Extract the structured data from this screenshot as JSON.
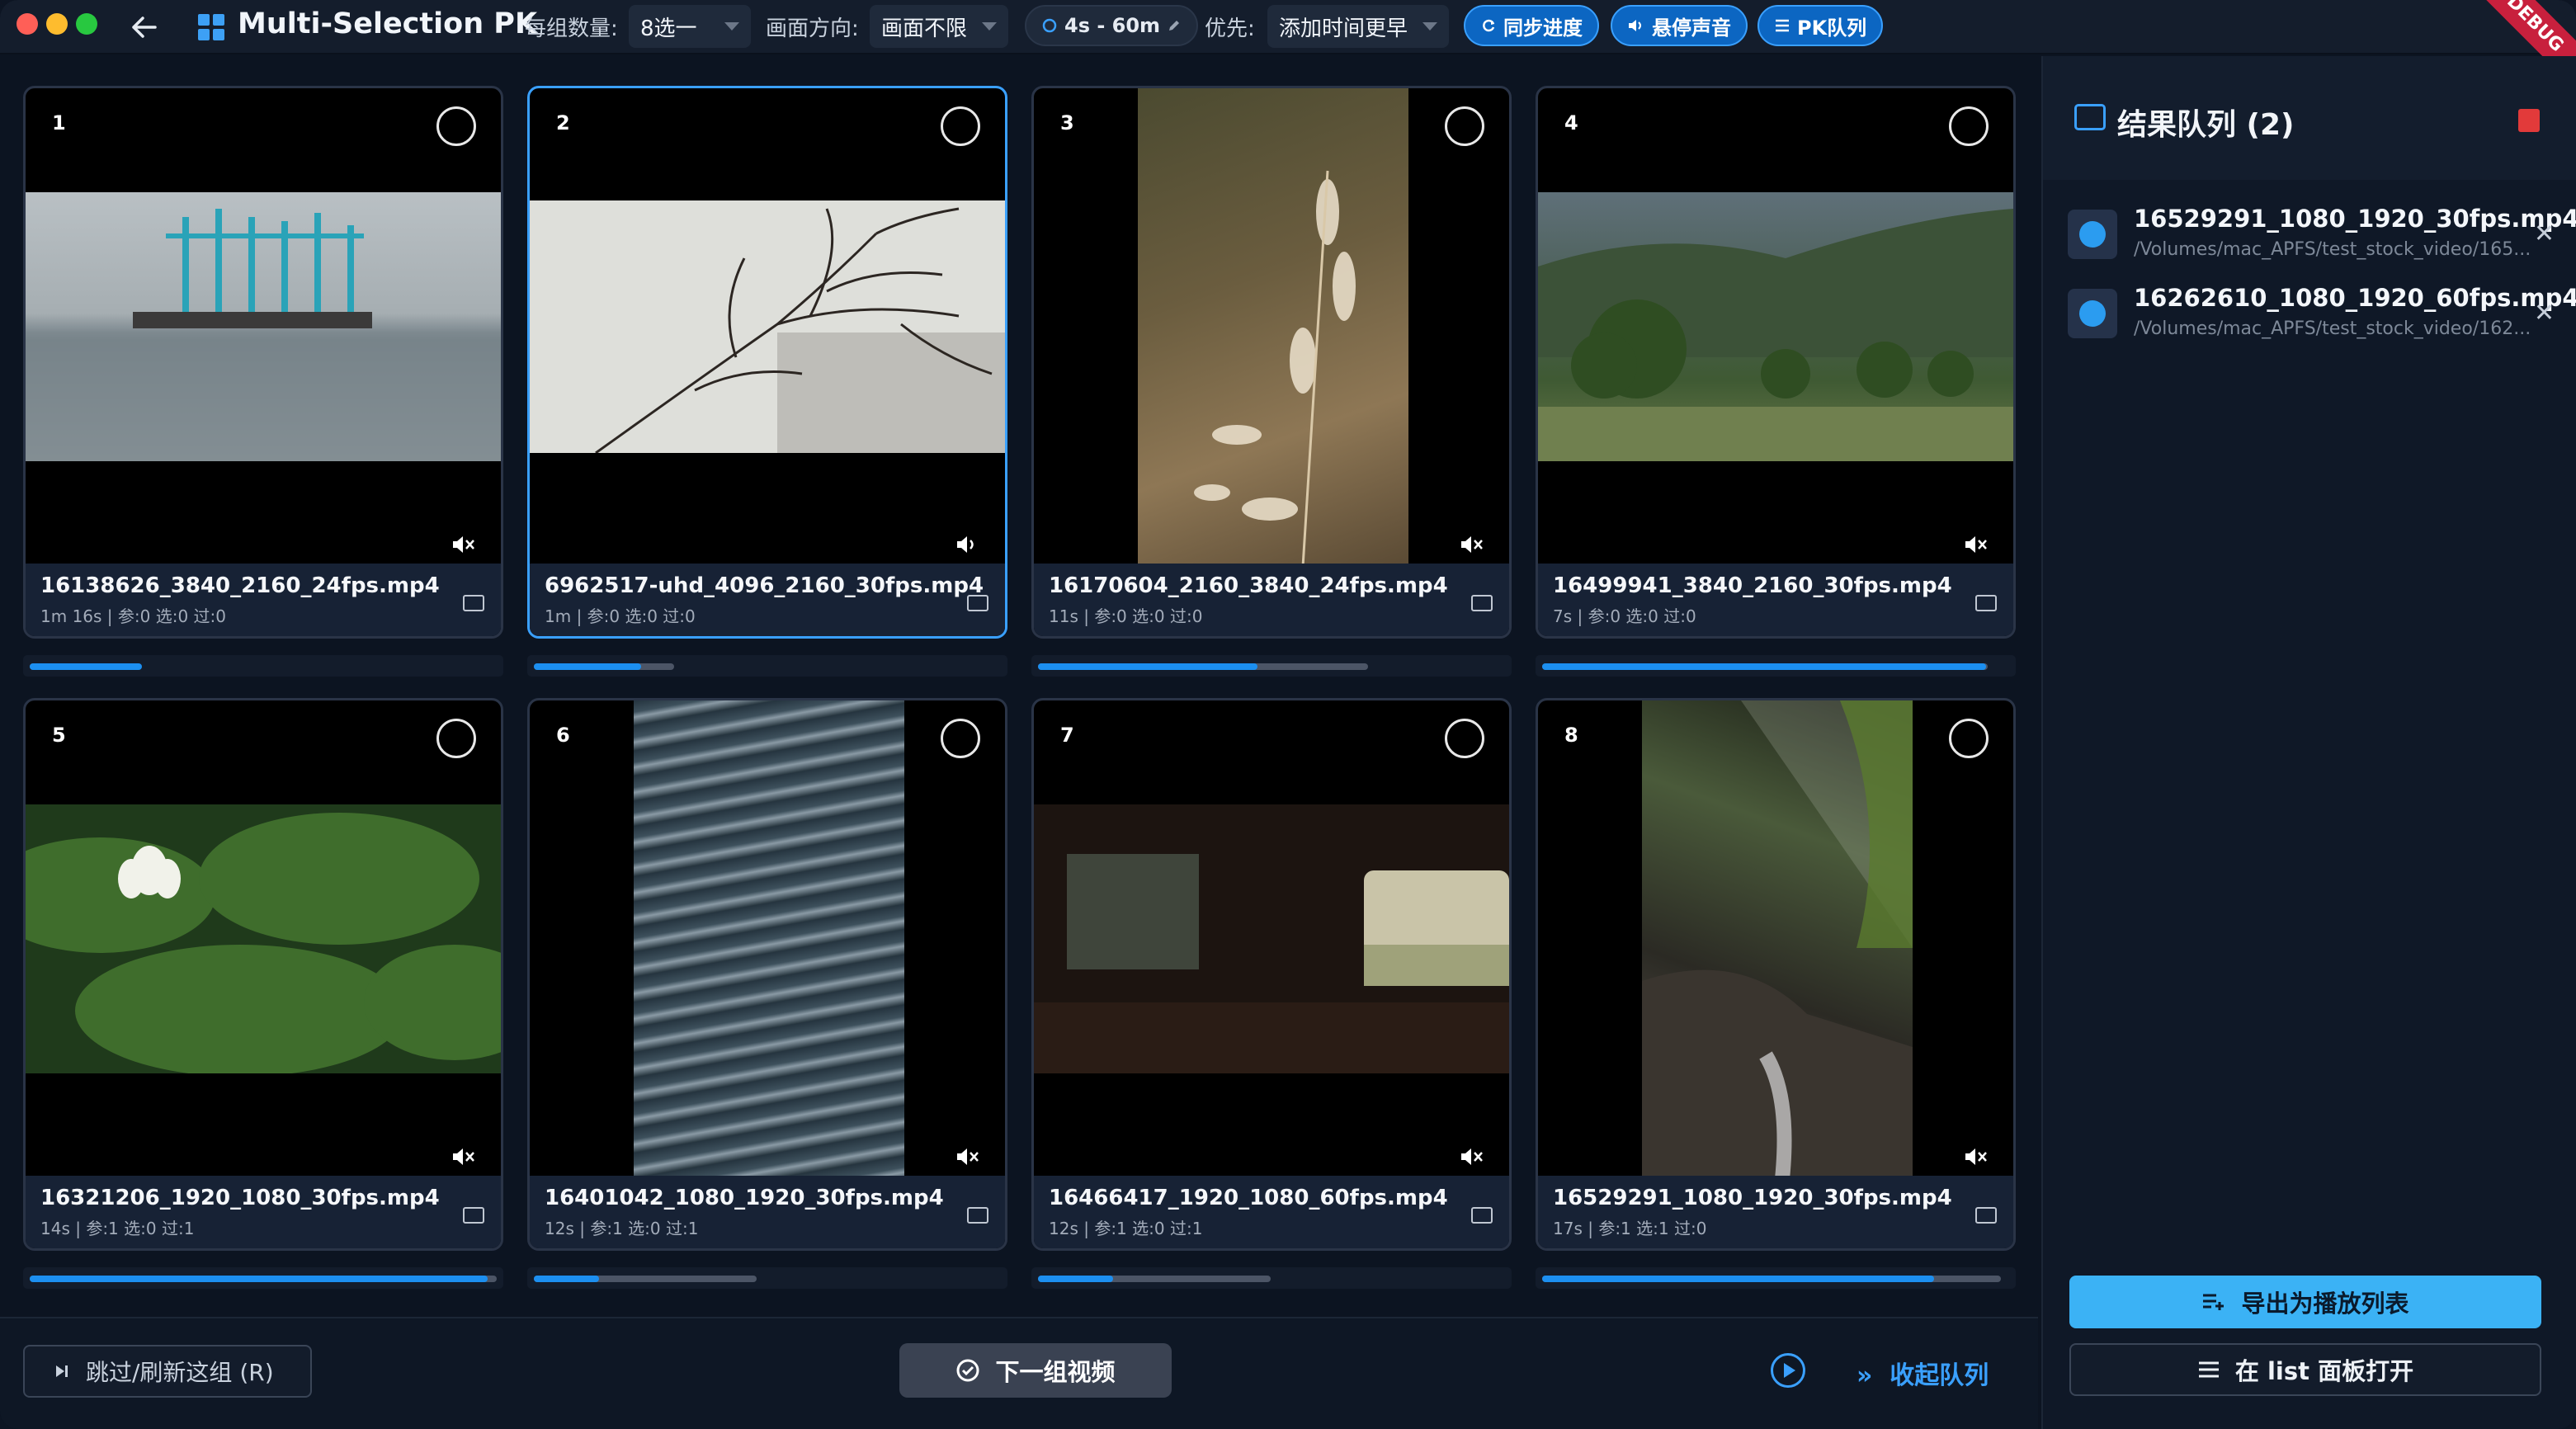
{
  "header": {
    "title": "Multi-Selection PK",
    "group_count_label": "每组数量:",
    "group_count_value": "8选一",
    "orientation_label": "画面方向:",
    "orientation_value": "画面不限",
    "duration_range": "4s - 60m",
    "priority_label": "优先:",
    "priority_value": "添加时间更早",
    "sync_progress": "同步进度",
    "hover_sound": "悬停声音",
    "pk_queue": "PK队列",
    "debug_badge": "DEBUG"
  },
  "cards": [
    {
      "index": "1",
      "filename": "16138626_3840_2160_24fps.mp4",
      "meta": "1m 16s | 参:0 选:0 过:0",
      "progress": 0.24,
      "muted": true,
      "active": false
    },
    {
      "index": "2",
      "filename": "6962517-uhd_4096_2160_30fps.mp4",
      "meta": "1m | 参:0 选:0 过:0",
      "progress": 0.23,
      "muted": false,
      "active": true
    },
    {
      "index": "3",
      "filename": "16170604_2160_3840_24fps.mp4",
      "meta": "11s | 参:0 选:0 过:0",
      "progress": 0.47,
      "muted": true,
      "active": false
    },
    {
      "index": "4",
      "filename": "16499941_3840_2160_30fps.mp4",
      "meta": "7s | 参:0 选:0 过:0",
      "progress": 0.95,
      "muted": true,
      "active": false
    },
    {
      "index": "5",
      "filename": "16321206_1920_1080_30fps.mp4",
      "meta": "14s | 参:1 选:0 过:1",
      "progress": 0.98,
      "muted": true,
      "active": false
    },
    {
      "index": "6",
      "filename": "16401042_1080_1920_30fps.mp4",
      "meta": "12s | 参:1 选:0 过:1",
      "progress": 0.14,
      "muted": true,
      "active": false
    },
    {
      "index": "7",
      "filename": "16466417_1920_1080_60fps.mp4",
      "meta": "12s | 参:1 选:0 过:1",
      "progress": 0.16,
      "muted": true,
      "active": false
    },
    {
      "index": "8",
      "filename": "16529291_1080_1920_30fps.mp4",
      "meta": "17s | 参:1 选:1 过:0",
      "progress": 0.84,
      "muted": true,
      "active": false
    }
  ],
  "bottom": {
    "skip_label": "跳过/刷新这组 (R)",
    "next_label": "下一组视频",
    "collapse_label": "收起队列"
  },
  "panel": {
    "title": "结果队列 (2)",
    "items": [
      {
        "name": "16529291_1080_1920_30fps.mp4",
        "path": "/Volumes/mac_APFS/test_stock_video/165..."
      },
      {
        "name": "16262610_1080_1920_60fps.mp4",
        "path": "/Volumes/mac_APFS/test_stock_video/162..."
      }
    ],
    "export_label": "导出为播放列表",
    "open_list_label": "在 list 面板打开"
  },
  "colors": {
    "accent": "#3aa0ff",
    "progress": "#1c8ff0",
    "bg": "#0c1421",
    "card_info": "#172235",
    "export_btn": "#3bb2f5"
  }
}
